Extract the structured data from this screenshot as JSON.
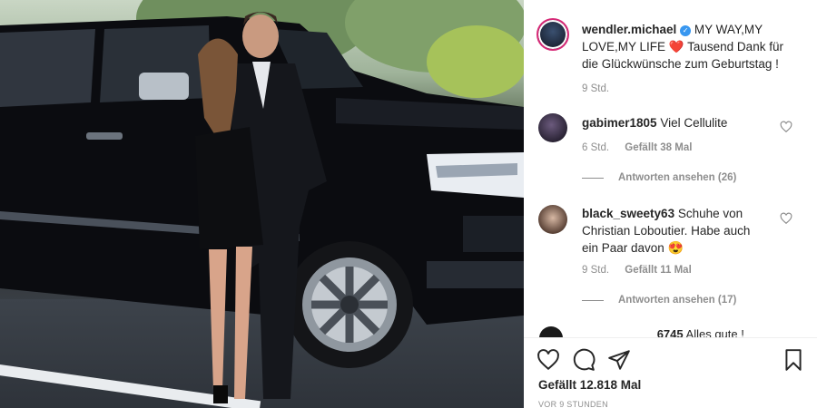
{
  "post": {
    "author": "wendler.michael",
    "caption": "MY WAY,MY LOVE,MY LIFE",
    "caption_emoji": "❤️",
    "caption_rest": "Tausend Dank für die Glückwünsche zum Geburtstag !",
    "time": "9 Std."
  },
  "comments": [
    {
      "user": "gabimer1805",
      "text": "Viel Cellulite",
      "time": "6 Std.",
      "likes": "Gefällt 38 Mal",
      "replies": "Antworten ansehen (26)"
    },
    {
      "user": "black_sweety63",
      "text": "Schuhe von Christian Loboutier. Habe auch ein Paar davon",
      "emoji": "😍",
      "time": "9 Std.",
      "likes": "Gefällt 11 Mal",
      "replies": "Antworten ansehen (17)"
    }
  ],
  "cut_comment": {
    "user": "___6745",
    "text": "Alles gute !"
  },
  "footer": {
    "likes": "Gefällt 12.818 Mal",
    "ago": "VOR 9 STUNDEN"
  },
  "icons": {
    "like": "heart-outline-icon",
    "comment": "speech-bubble-icon",
    "share": "paper-plane-icon",
    "save": "bookmark-icon"
  },
  "colors": {
    "heart": "#e0245e",
    "muted": "#8e8e8e",
    "text": "#262626"
  }
}
